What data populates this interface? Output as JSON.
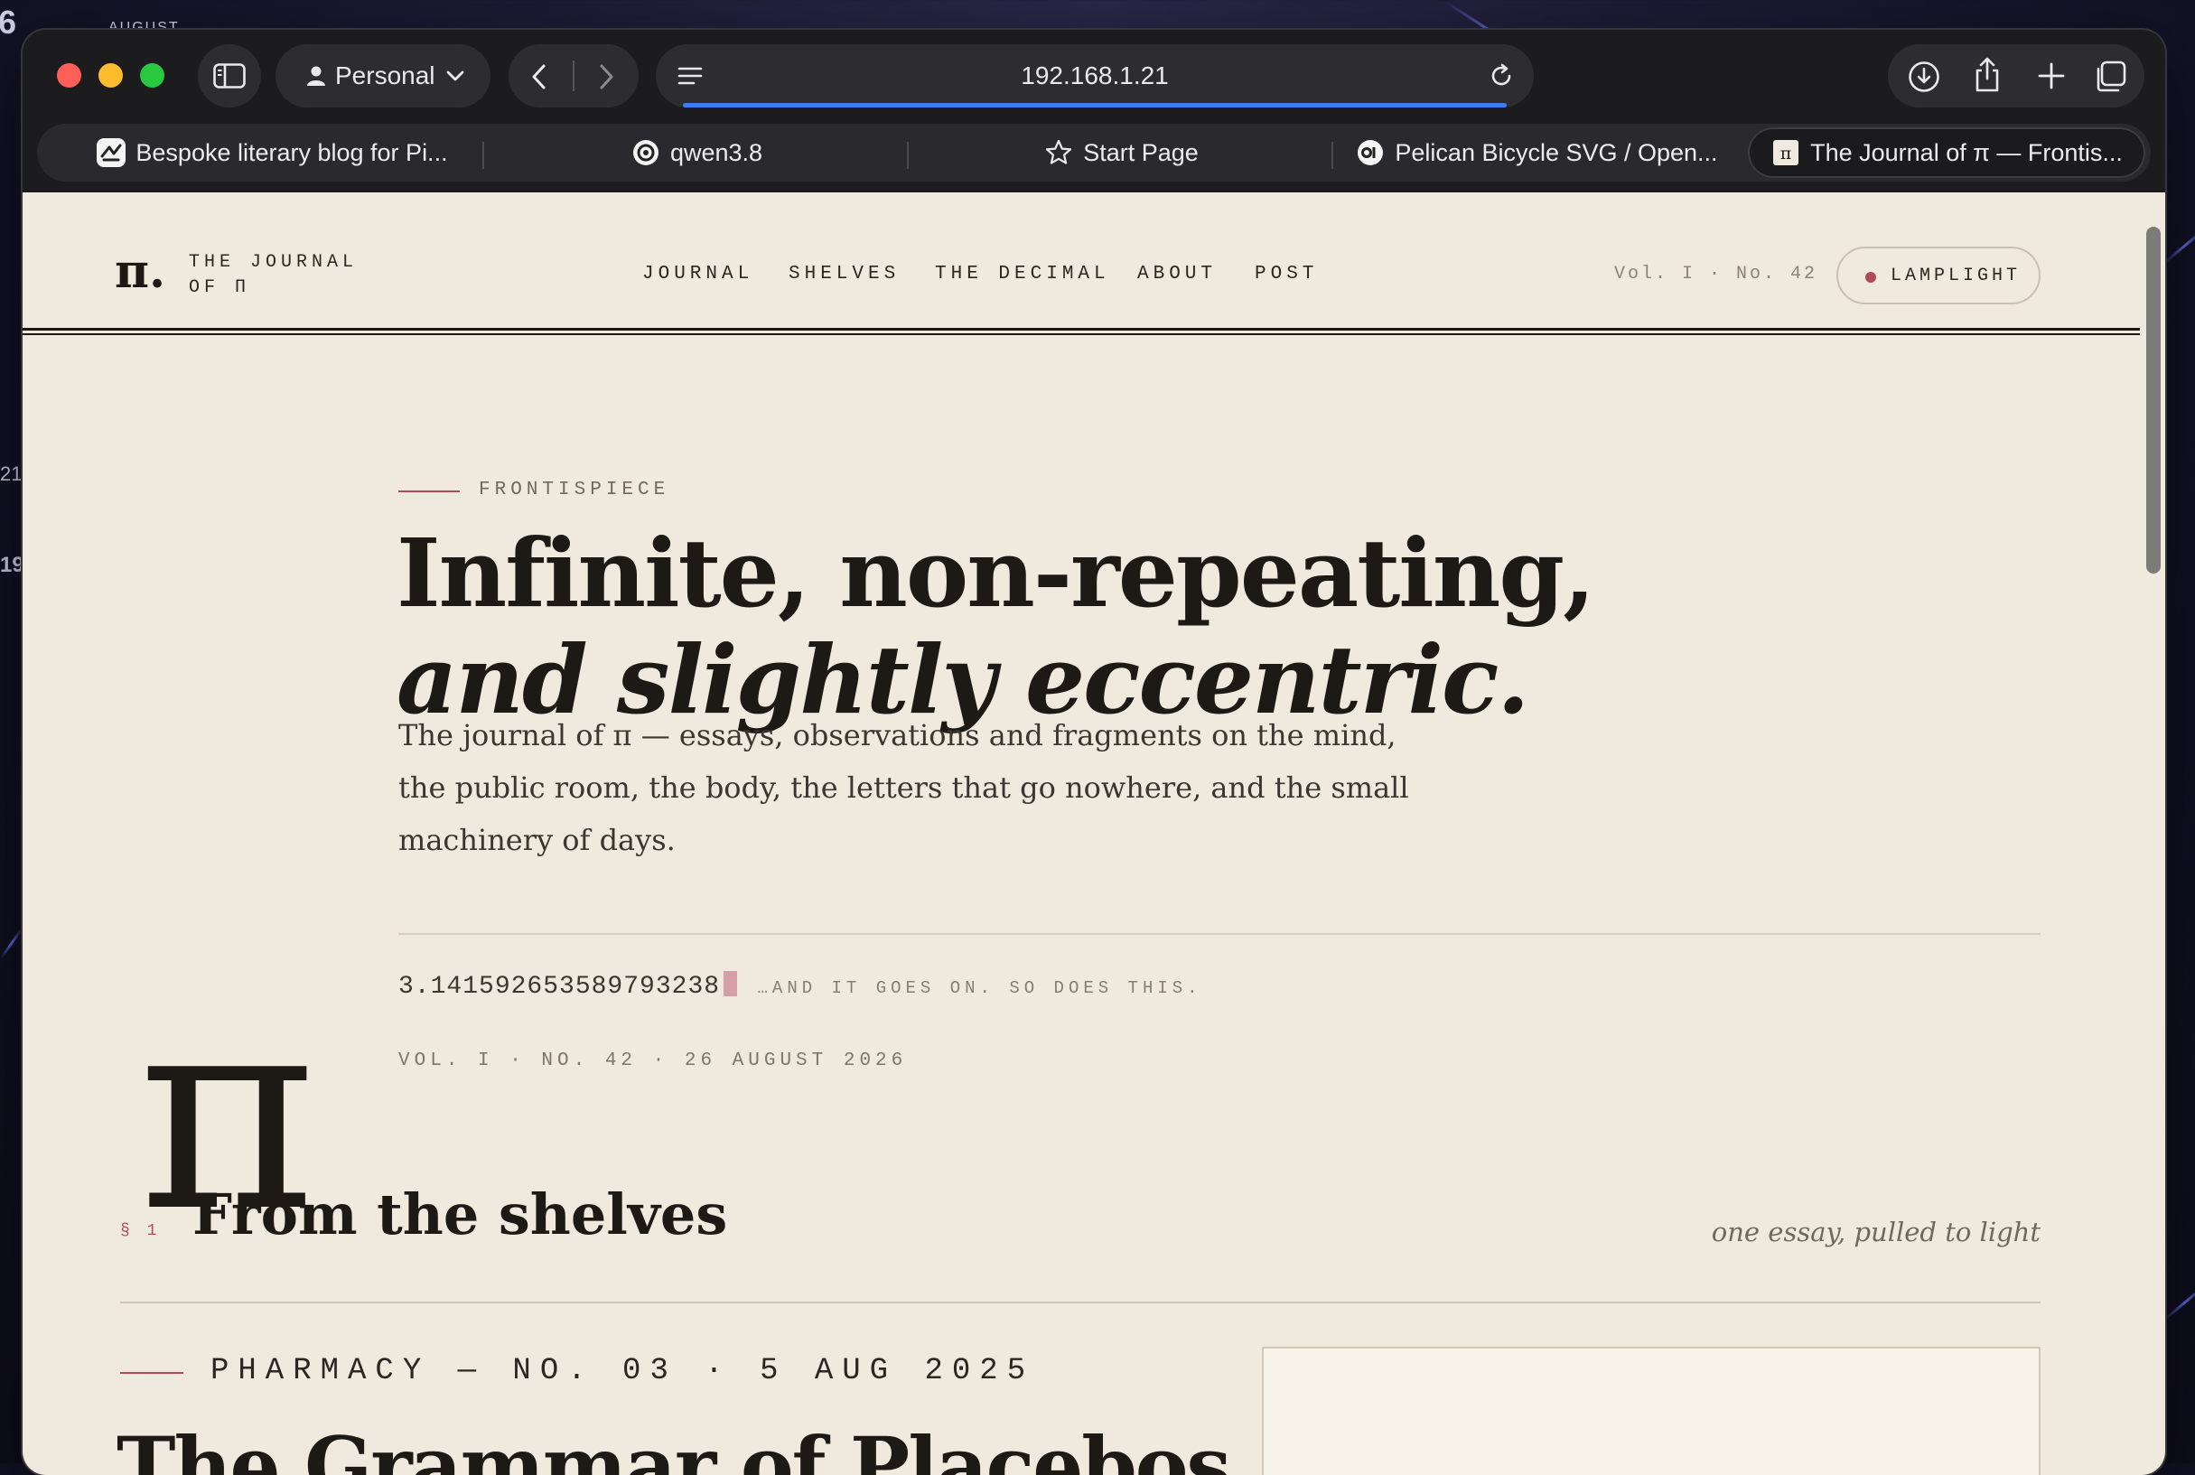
{
  "desktop": {
    "glyphs": [
      "6",
      "AUGUST",
      "21",
      "19"
    ]
  },
  "browser": {
    "profile_label": "Personal",
    "address": "192.168.1.21",
    "tabs": [
      {
        "title": "Bespoke literary blog for Pi...",
        "icon": "app-icon"
      },
      {
        "title": "qwen3.8",
        "icon": "qwen-icon"
      },
      {
        "title": "Start Page",
        "icon": "star-icon"
      },
      {
        "title": "Pelican Bicycle SVG / Open...",
        "icon": "openrouter-icon"
      },
      {
        "title": "The Journal of π — Frontis...",
        "icon": "pi-icon",
        "active": true
      }
    ]
  },
  "site": {
    "logo_mark": "π.",
    "logo_line1": "THE JOURNAL",
    "logo_line2": "OF Π",
    "nav": [
      "JOURNAL",
      "SHELVES",
      "THE DECIMAL",
      "ABOUT",
      "POST"
    ],
    "issue": "Vol. I · No. 42",
    "lamp_button": "LAMPLIGHT",
    "accent": "#b04a57"
  },
  "hero": {
    "eyebrow": "FRONTISPIECE",
    "title_line1": "Infinite, non-repeating,",
    "title_line2": "and slightly eccentric.",
    "lede": "The journal of π — essays, observations and fragments on the mind, the public room, the body, the letters that go nowhere, and the small machinery of days.",
    "pi_symbol": "π",
    "digits": "3.141592653589793238",
    "digits_note": "…AND IT GOES ON. SO DOES THIS.",
    "dateline": "VOL. I · NO. 42 · 26 AUGUST 2026"
  },
  "shelves": {
    "section_mark": "§ 1",
    "heading": "From the shelves",
    "aside": "one essay, pulled to light",
    "kicker": "PHARMACY — NO. 03 · 5 AUG 2025",
    "article_title": "The Grammar of Placebos"
  }
}
